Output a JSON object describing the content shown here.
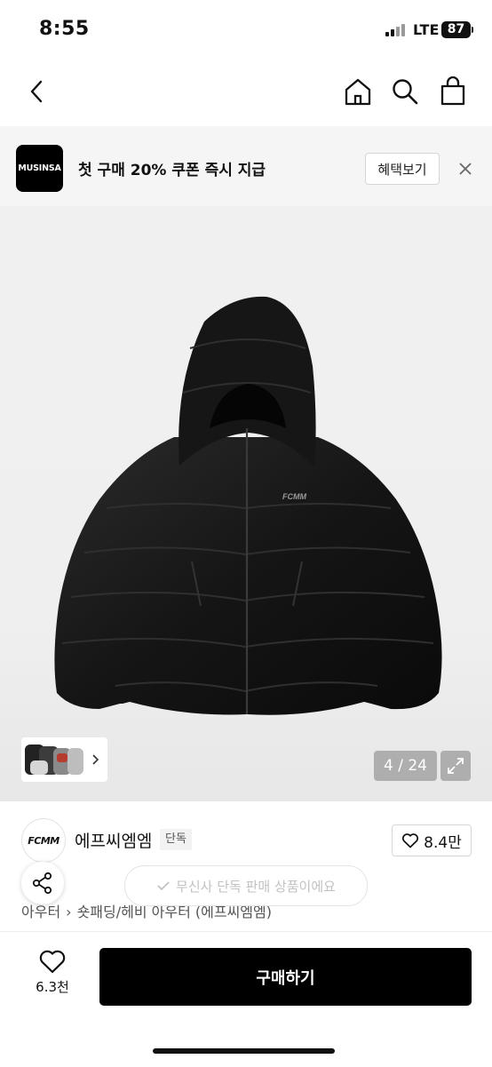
{
  "status_bar": {
    "time": "8:55",
    "network": "LTE",
    "battery": "87"
  },
  "nav": {
    "back_icon": "chevron-left-icon",
    "home_icon": "home-icon",
    "search_icon": "search-icon",
    "cart_icon": "shopping-bag-icon"
  },
  "promo": {
    "logo": "MUSINSA",
    "text": "첫 구매 20% 쿠폰 즉시 지급",
    "button": "혜택보기"
  },
  "gallery": {
    "counter": "4 / 24",
    "logo_print": "FCMM"
  },
  "brand": {
    "logo": "FCMM",
    "name": "에프씨엠엠",
    "badge": "단독",
    "likes": "8.4만"
  },
  "toast": {
    "text": "무신사 단독 판매 상품이에요"
  },
  "breadcrumb": [
    "아우터",
    "숏패딩/헤비 아우터 (에프씨엠엠)"
  ],
  "bottom": {
    "wish_count": "6.3천",
    "buy_label": "구매하기"
  },
  "colors": {
    "brand": "#000000",
    "background": "#ffffff",
    "banner": "#f5f5f5"
  }
}
